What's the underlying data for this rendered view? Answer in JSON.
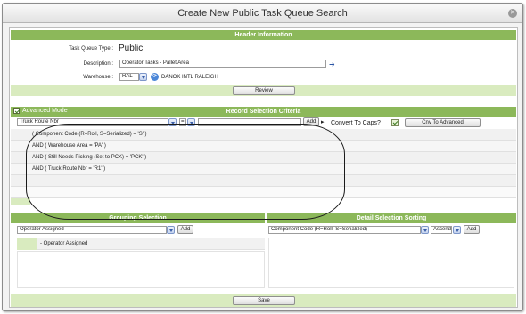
{
  "window": {
    "title": "Create New Public Task Queue Search"
  },
  "header": {
    "bar_title": "Header Information",
    "task_queue_type_label": "Task Queue Type :",
    "task_queue_type_value": "Public",
    "description_label": "Description :",
    "description_value": "Operator Tasks - Pallet Area",
    "warehouse_label": "Warehouse :",
    "warehouse_value": "RAL",
    "warehouse_name": "DANOK INTL RALEIGH",
    "review_button": "Review"
  },
  "record_selection": {
    "bar_title": "Record Selection Criteria",
    "advanced_mode_label": "Advanced Mode",
    "field_select": "Truck Route Nbr",
    "operator_select": "=",
    "add_button": "Add",
    "convert_caps_label": "Convert To Caps?",
    "convert_advanced_button": "Cnv To Advanced",
    "criteria": [
      "( Component Code (R=Roll, S=Serialized) = 'S' )",
      "AND  ( Warehouse Area = 'PA' )",
      "AND  ( Still Needs Picking (Set to PCK) = 'PCK' )",
      "AND  ( Truck Route Nbr = 'R1' )"
    ]
  },
  "grouping": {
    "bar_title": "Grouping Selection",
    "select_value": "Operator Assigned",
    "add_button": "Add",
    "items": [
      "- Operator Assigned"
    ]
  },
  "sorting": {
    "bar_title": "Detail Selection Sorting",
    "select_value": "Component Code (R=Roll, S=Serialized)",
    "order_value": "Ascend",
    "add_button": "Add"
  },
  "footer": {
    "save_button": "Save"
  }
}
